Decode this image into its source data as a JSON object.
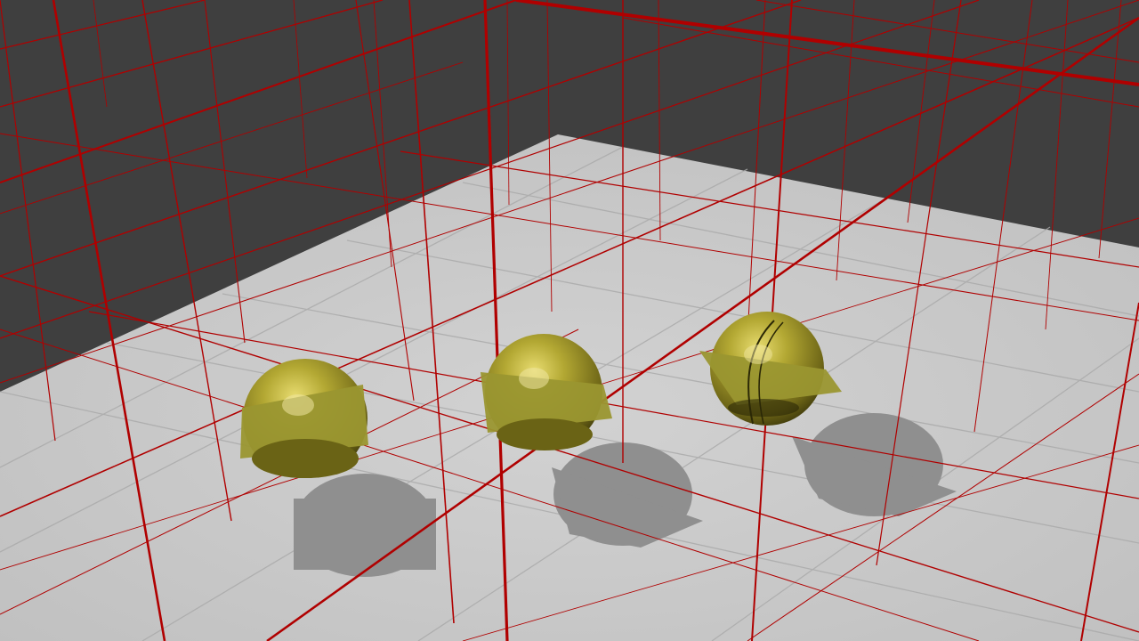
{
  "scene": {
    "background_color": "#3f3f3f",
    "floor_color": "#c8c8c8",
    "floor_shadow_color": "#8f8f8f",
    "grid_line_color": "#b00000",
    "floor_grid_color": "#a8a8a8",
    "sphere_color": "#b3a833",
    "sphere_dark_color": "#4d4710",
    "disc_color": "#9a9630",
    "objects": [
      {
        "name": "sphere-left"
      },
      {
        "name": "sphere-middle"
      },
      {
        "name": "sphere-right"
      }
    ]
  }
}
